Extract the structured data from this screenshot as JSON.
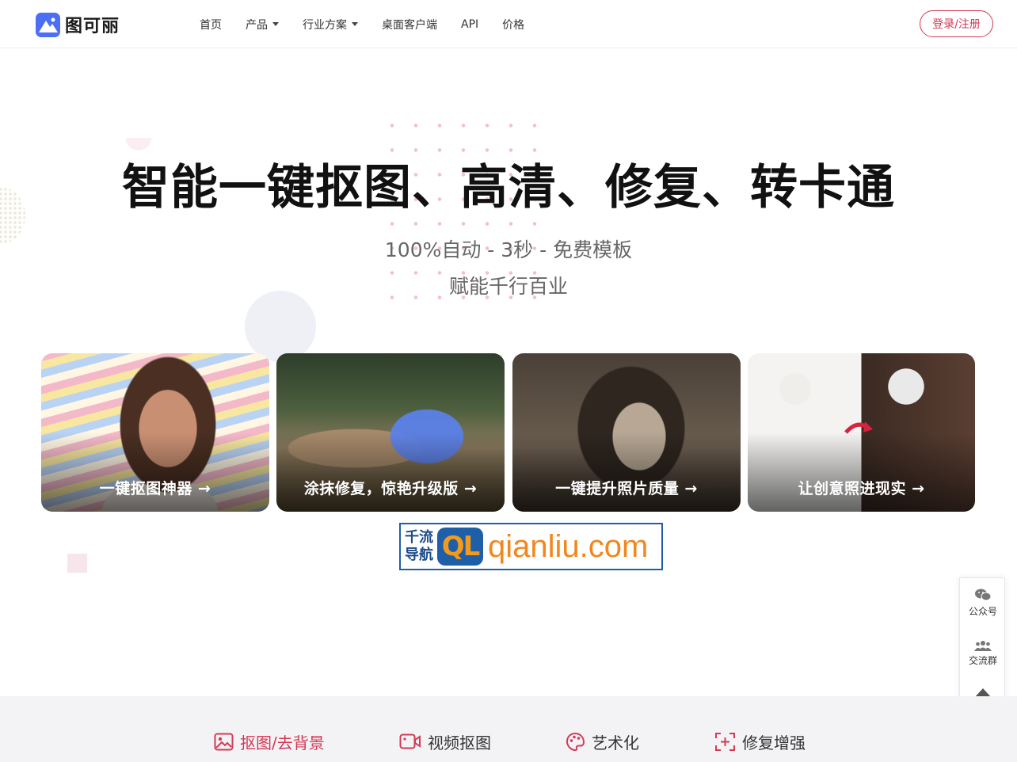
{
  "brand": {
    "name": "图可丽",
    "accent": "#d23a56",
    "logo_color": "#4b6ef5"
  },
  "nav": {
    "items": [
      {
        "label": "首页",
        "has_dropdown": false
      },
      {
        "label": "产品",
        "has_dropdown": true
      },
      {
        "label": "行业方案",
        "has_dropdown": true
      },
      {
        "label": "桌面客户端",
        "has_dropdown": false
      },
      {
        "label": "API",
        "has_dropdown": false
      },
      {
        "label": "价格",
        "has_dropdown": false
      }
    ],
    "login_label": "登录/注册"
  },
  "hero": {
    "title": "智能一键抠图、高清、修复、转卡通",
    "subtitle_1": "100%自动 - 3秒 - 免费模板",
    "subtitle_2": "赋能千行百业"
  },
  "cards": [
    {
      "label": "一键抠图神器 →"
    },
    {
      "label": "涂抹修复，惊艳升级版 →"
    },
    {
      "label": "一键提升照片质量 →"
    },
    {
      "label": "让创意照进现实 →"
    }
  ],
  "watermark": {
    "left_line_1": "千流",
    "left_line_2": "导航",
    "mark": "QL",
    "domain": "qianliu.com"
  },
  "side_bar": {
    "wechat_label": "公众号",
    "group_label": "交流群",
    "icons": [
      "wechat-icon",
      "group-icon",
      "arrow-up-icon"
    ]
  },
  "feature_tabs": [
    {
      "label": "抠图/去背景",
      "icon": "image-icon",
      "active": true
    },
    {
      "label": "视频抠图",
      "icon": "video-icon",
      "active": false
    },
    {
      "label": "艺术化",
      "icon": "palette-icon",
      "active": false
    },
    {
      "label": "修复增强",
      "icon": "enhance-icon",
      "active": false
    }
  ]
}
